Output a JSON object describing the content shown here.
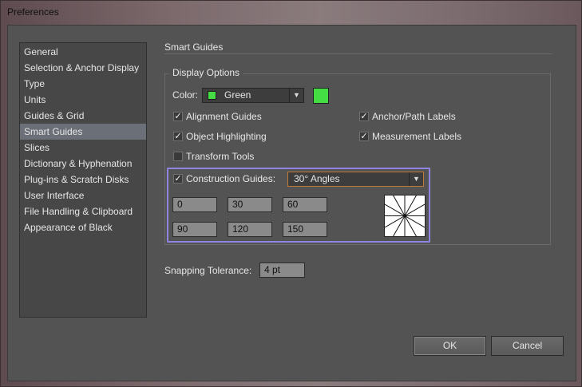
{
  "window": {
    "title": "Preferences"
  },
  "sidebar": {
    "items": [
      {
        "label": "General",
        "selected": false
      },
      {
        "label": "Selection & Anchor Display",
        "selected": false
      },
      {
        "label": "Type",
        "selected": false
      },
      {
        "label": "Units",
        "selected": false
      },
      {
        "label": "Guides & Grid",
        "selected": false
      },
      {
        "label": "Smart Guides",
        "selected": true
      },
      {
        "label": "Slices",
        "selected": false
      },
      {
        "label": "Dictionary & Hyphenation",
        "selected": false
      },
      {
        "label": "Plug-ins & Scratch Disks",
        "selected": false
      },
      {
        "label": "User Interface",
        "selected": false
      },
      {
        "label": "File Handling & Clipboard",
        "selected": false
      },
      {
        "label": "Appearance of Black",
        "selected": false
      }
    ]
  },
  "section": {
    "title": "Smart Guides"
  },
  "display_options": {
    "legend": "Display Options",
    "color": {
      "label": "Color:",
      "value": "Green",
      "swatch": "#44dd44"
    },
    "checkboxes": {
      "alignment_guides": {
        "label": "Alignment Guides",
        "checked": true
      },
      "object_highlighting": {
        "label": "Object Highlighting",
        "checked": true
      },
      "transform_tools": {
        "label": "Transform Tools",
        "checked": false
      },
      "anchor_path_labels": {
        "label": "Anchor/Path Labels",
        "checked": true
      },
      "measurement_labels": {
        "label": "Measurement Labels",
        "checked": true
      }
    },
    "construction_guides": {
      "label": "Construction Guides:",
      "checked": true,
      "value": "30° Angles",
      "angles": [
        "0",
        "30",
        "60",
        "90",
        "120",
        "150"
      ]
    }
  },
  "snapping": {
    "label": "Snapping Tolerance:",
    "value": "4 pt"
  },
  "buttons": {
    "ok": "OK",
    "cancel": "Cancel"
  },
  "colors": {
    "accent_highlight": "#8f84e0",
    "selection": "#6a6f78"
  }
}
